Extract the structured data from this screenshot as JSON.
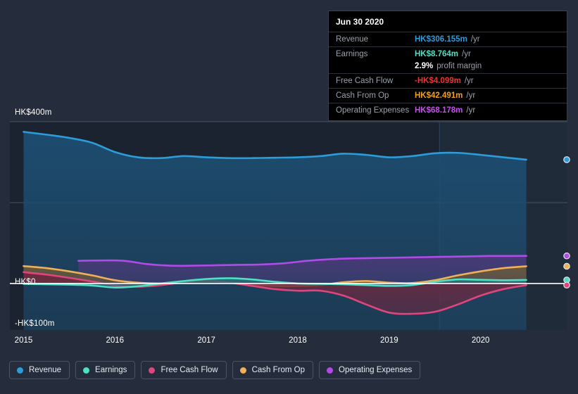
{
  "chart_data": {
    "type": "area",
    "title": "",
    "xlabel": "",
    "ylabel": "",
    "currency": "HK$",
    "grid": true,
    "legend_position": "bottom",
    "ylim": [
      -100,
      400
    ],
    "y_ticks": [
      {
        "value": 400,
        "label": "HK$400m"
      },
      {
        "value": 0,
        "label": "HK$0"
      },
      {
        "value": -100,
        "label": "-HK$100m"
      }
    ],
    "y_gridlines": [
      400,
      200
    ],
    "x_ticks": [
      "2015",
      "2016",
      "2017",
      "2018",
      "2019",
      "2020"
    ],
    "xlim": [
      "2014.85",
      "2020.95"
    ],
    "forecast_divider_x": "2019.55",
    "series": [
      {
        "name": "Revenue",
        "color": "#2d9cdb",
        "fill": "#1d4e72",
        "x": [
          2015.0,
          2015.25,
          2015.5,
          2015.75,
          2016.0,
          2016.25,
          2016.5,
          2016.75,
          2017.0,
          2017.25,
          2017.5,
          2017.75,
          2018.0,
          2018.25,
          2018.5,
          2018.75,
          2019.0,
          2019.25,
          2019.5,
          2019.75,
          2020.0,
          2020.25,
          2020.5
        ],
        "values": [
          375,
          368,
          360,
          348,
          325,
          312,
          310,
          315,
          312,
          310,
          310,
          311,
          312,
          315,
          321,
          318,
          312,
          315,
          322,
          323,
          318,
          312,
          306.155
        ]
      },
      {
        "name": "Earnings",
        "color": "#4ee0c4",
        "fill": "#2c6f7a",
        "x": [
          2015.0,
          2015.25,
          2015.5,
          2015.75,
          2016.0,
          2016.25,
          2016.5,
          2016.75,
          2017.0,
          2017.25,
          2017.5,
          2017.75,
          2018.0,
          2018.25,
          2018.5,
          2018.75,
          2019.0,
          2019.25,
          2019.5,
          2019.75,
          2020.0,
          2020.25,
          2020.5
        ],
        "values": [
          -1,
          -2,
          -3,
          -5,
          -10,
          -7,
          0,
          6,
          11,
          13,
          10,
          4,
          0,
          -1,
          -2,
          -4,
          -6,
          -4,
          4,
          10,
          9,
          8,
          8.764
        ]
      },
      {
        "name": "Free Cash Flow",
        "color": "#e0467e",
        "fill": "#6d2840",
        "x": [
          2015.0,
          2015.25,
          2015.5,
          2015.75,
          2016.0,
          2016.25,
          2016.5,
          2016.75,
          2017.0,
          2017.25,
          2017.5,
          2017.75,
          2018.0,
          2018.25,
          2018.5,
          2018.75,
          2019.0,
          2019.25,
          2019.5,
          2019.75,
          2020.0,
          2020.25,
          2020.5
        ],
        "values": [
          28,
          22,
          14,
          5,
          -5,
          -8,
          -4,
          3,
          7,
          2,
          -6,
          -14,
          -18,
          -18,
          -30,
          -52,
          -72,
          -75,
          -70,
          -52,
          -30,
          -14,
          -4.099
        ]
      },
      {
        "name": "Cash From Op",
        "color": "#f0b055",
        "fill": "#6b5a3a",
        "x": [
          2015.0,
          2015.25,
          2015.5,
          2015.75,
          2016.0,
          2016.25,
          2016.5,
          2016.75,
          2017.0,
          2017.25,
          2017.5,
          2017.75,
          2018.0,
          2018.25,
          2018.5,
          2018.75,
          2019.0,
          2019.25,
          2019.5,
          2019.75,
          2020.0,
          2020.25,
          2020.5
        ],
        "values": [
          43,
          38,
          30,
          20,
          8,
          2,
          0,
          2,
          5,
          2,
          -3,
          -6,
          -6,
          -4,
          3,
          6,
          2,
          1,
          8,
          20,
          30,
          38,
          42.491
        ]
      },
      {
        "name": "Operating Expenses",
        "color": "#b24ae8",
        "fill": "#4a3a78",
        "x": [
          2015.6,
          2015.85,
          2016.1,
          2016.35,
          2016.6,
          2016.85,
          2017.1,
          2017.35,
          2017.6,
          2017.85,
          2018.1,
          2018.35,
          2018.6,
          2018.85,
          2019.1,
          2019.35,
          2019.6,
          2019.85,
          2020.1,
          2020.35,
          2020.5
        ],
        "values": [
          56,
          57,
          56,
          48,
          44,
          44,
          45,
          46,
          47,
          50,
          56,
          60,
          62,
          63,
          64,
          65,
          66,
          67,
          68,
          68,
          68.178
        ]
      }
    ]
  },
  "tooltip": {
    "title": "Jun 30 2020",
    "rows": [
      {
        "label": "Revenue",
        "value": "HK$306.155m",
        "unit": "/yr",
        "color": "#2d9cdb"
      },
      {
        "label": "Earnings",
        "value": "HK$8.764m",
        "unit": "/yr",
        "color": "#4ee0c4"
      },
      {
        "label": "",
        "value": "2.9%",
        "sublabel": "profit margin",
        "color": "#ffffff",
        "sub": true
      },
      {
        "label": "Free Cash Flow",
        "value": "-HK$4.099m",
        "unit": "/yr",
        "color": "#e8352e"
      },
      {
        "label": "Cash From Op",
        "value": "HK$42.491m",
        "unit": "/yr",
        "color": "#f0a020"
      },
      {
        "label": "Operating Expenses",
        "value": "HK$68.178m",
        "unit": "/yr",
        "color": "#c84ef0"
      }
    ]
  },
  "legend": {
    "items": [
      {
        "label": "Revenue",
        "color": "#2d9cdb"
      },
      {
        "label": "Earnings",
        "color": "#4ee0c4"
      },
      {
        "label": "Free Cash Flow",
        "color": "#e0467e"
      },
      {
        "label": "Cash From Op",
        "color": "#f0b055"
      },
      {
        "label": "Operating Expenses",
        "color": "#b24ae8"
      }
    ]
  }
}
